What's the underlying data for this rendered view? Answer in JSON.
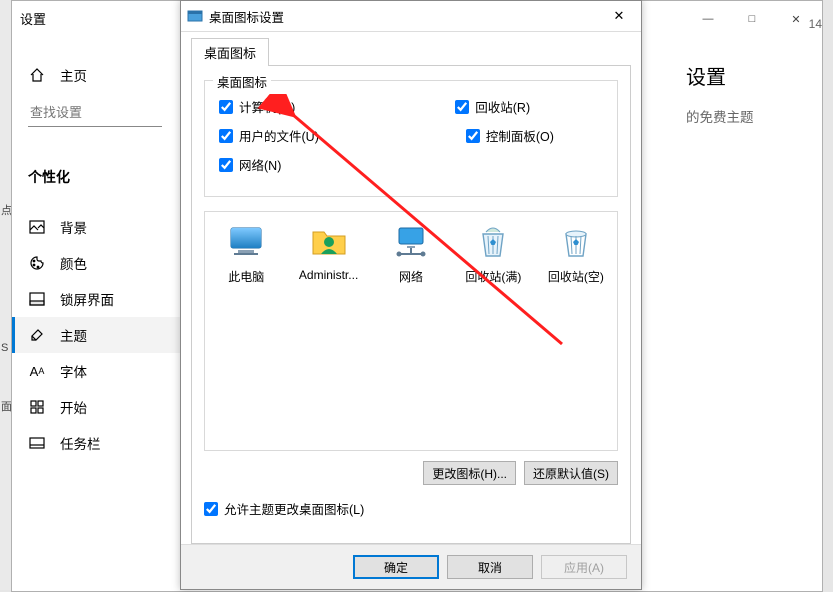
{
  "mainWindow": {
    "title": "设置",
    "minimize": "—",
    "maximize": "□",
    "close": "✕",
    "sideHint": "14"
  },
  "sidebar": {
    "home": "主页",
    "searchPlaceholder": "查找设置",
    "category": "个性化",
    "items": [
      "背景",
      "颜色",
      "锁屏界面",
      "主题",
      "字体",
      "开始",
      "任务栏"
    ]
  },
  "rightPane": {
    "header": "设置",
    "sub": "的免费主题"
  },
  "dialog": {
    "title": "桌面图标设置",
    "close": "✕",
    "tab": "桌面图标",
    "group": {
      "label": "桌面图标",
      "checks": {
        "computer": {
          "label": "计算机(M)",
          "checked": true
        },
        "recycle": {
          "label": "回收站(R)",
          "checked": true
        },
        "userfiles": {
          "label": "用户的文件(U)",
          "checked": true
        },
        "control": {
          "label": "控制面板(O)",
          "checked": true
        },
        "network": {
          "label": "网络(N)",
          "checked": true
        }
      }
    },
    "icons": [
      "此电脑",
      "Administr...",
      "网络",
      "回收站(满)",
      "回收站(空)"
    ],
    "changeIcon": "更改图标(H)...",
    "restoreDefault": "还原默认值(S)",
    "allowThemeChange": {
      "label": "允许主题更改桌面图标(L)",
      "checked": true
    },
    "ok": "确定",
    "cancel": "取消",
    "apply": "应用(A)"
  },
  "edge": [
    "点",
    "S",
    "面"
  ]
}
